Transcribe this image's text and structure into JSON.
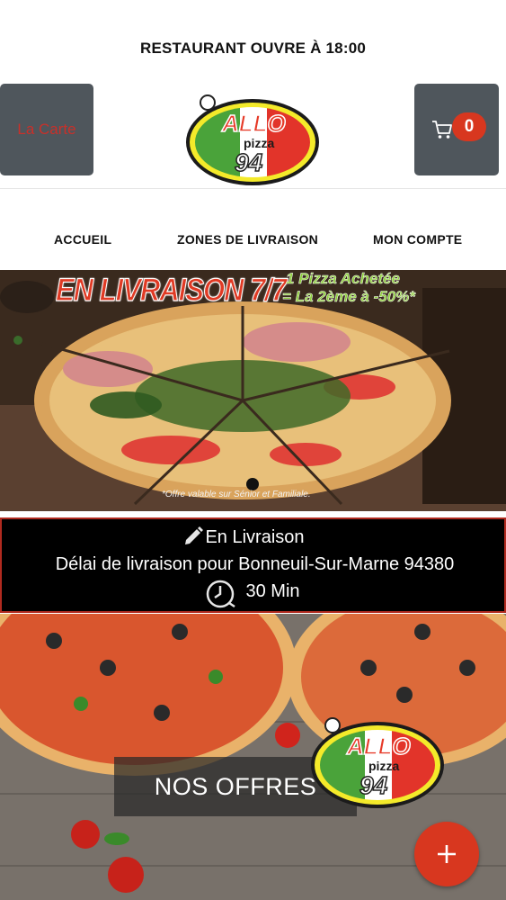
{
  "status_text": "RESTAURANT OUVRE À 18:00",
  "header": {
    "menu_button_label": "La Carte",
    "cart_count": "0",
    "logo_text_top": "ALLO",
    "logo_text_mid": "pizza",
    "logo_text_bottom": "94"
  },
  "nav": {
    "items": [
      "ACCUEIL",
      "ZONES DE LIVRAISON",
      "MON COMPTE"
    ]
  },
  "hero": {
    "title": "EN LIVRAISON 7/7",
    "promo_line1": "1 Pizza Achetée",
    "promo_line2": "= La 2ème à -50%*",
    "note": "*Offre valable sur Sénior et Familiale."
  },
  "delivery": {
    "mode": "En Livraison",
    "delay_text": "Délai de livraison pour Bonneuil-Sur-Marne 94380",
    "time": "30 Min"
  },
  "offers": {
    "label": "NOS OFFRES"
  },
  "fab_label": "+",
  "colors": {
    "accent": "#d8371f",
    "button_bg": "#4f565c",
    "menu_label": "#c8302a"
  }
}
